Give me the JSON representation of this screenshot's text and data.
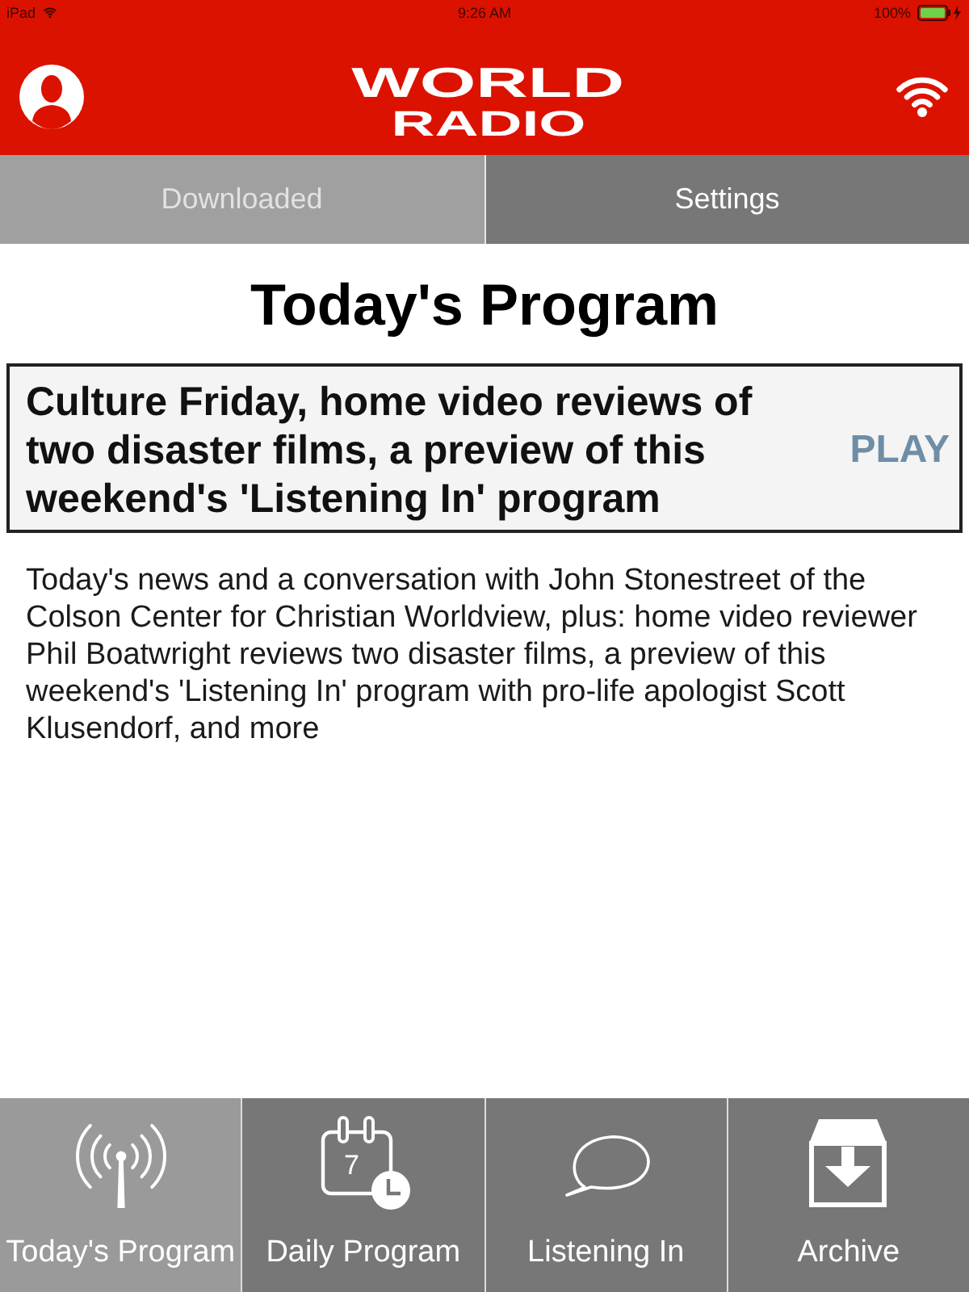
{
  "status_bar": {
    "device": "iPad",
    "time": "9:26 AM",
    "battery": "100%"
  },
  "header": {
    "logo": [
      "WORLD",
      "RADIO"
    ]
  },
  "segments": [
    {
      "label": "Downloaded",
      "disabled": true
    },
    {
      "label": "Settings",
      "disabled": false
    }
  ],
  "page_title": "Today's Program",
  "program": {
    "title": "Culture Friday, home video reviews of two disaster films, a preview of this weekend's 'Listening In' program",
    "action": "PLAY",
    "description": "Today's news and a conversation with John Stonestreet of the Colson Center for Christian Worldview, plus: home video reviewer Phil Boatwright reviews two disaster films, a preview of this weekend's 'Listening In' program with pro-life apologist Scott Klusendorf, and more"
  },
  "tab_bar": [
    {
      "kind": "antenna",
      "label": "Today's Program",
      "selected": true
    },
    {
      "kind": "calendar",
      "label": "Daily Program",
      "icon_text": "7",
      "selected": false
    },
    {
      "kind": "speech",
      "label": "Listening In",
      "selected": false
    },
    {
      "kind": "archive",
      "label": "Archive",
      "selected": false
    }
  ]
}
